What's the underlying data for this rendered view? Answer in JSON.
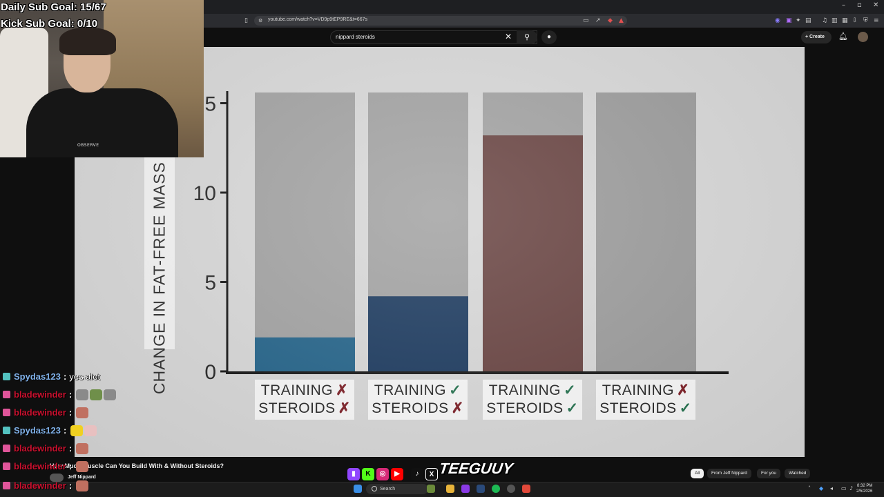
{
  "browser": {
    "url": "youtube.com/watch?v=VD9p9tEP9RE&t=667s"
  },
  "youtube": {
    "search_query": "nippard steroids",
    "create_label": "Create",
    "video_title": "How Much Muscle Can You Build With & Without Steroids?",
    "channel_name": "Jeff Nippard",
    "chips": [
      "All",
      "From Jeff Nippard",
      "For you",
      "Watched"
    ]
  },
  "chart_data": {
    "type": "bar",
    "title": "",
    "ylabel": "CHANGE IN FAT-FREE MASS (LBS)",
    "ylim": [
      0,
      15
    ],
    "yticks": [
      0,
      5,
      10,
      15
    ],
    "ytick_labels": [
      "0",
      "5",
      "10",
      "5"
    ],
    "categories": [
      {
        "line1": "TRAINING",
        "mark1": "✗",
        "line2": "STEROIDS",
        "mark2": "✗"
      },
      {
        "line1": "TRAINING",
        "mark1": "✓",
        "line2": "STEROIDS",
        "mark2": "✗"
      },
      {
        "line1": "TRAINING",
        "mark1": "✓",
        "line2": "STEROIDS",
        "mark2": "✓"
      },
      {
        "line1": "TRAINING",
        "mark1": "✗",
        "line2": "STEROIDS",
        "mark2": "✓"
      }
    ],
    "values": [
      1.9,
      4.2,
      13.2,
      null
    ],
    "bar_colors": [
      "#1e5f86",
      "#15345a",
      "#643e3c",
      "#9a9a9a"
    ],
    "background_bar_color": "#9f9f9f"
  },
  "stream": {
    "daily_sub_goal": "Daily Sub Goal: 15/67",
    "kick_sub_goal": "Kick Sub Goal: 0/10",
    "webcam_shirt_text": "OBSERVE",
    "social_handle": "TEEGUUY"
  },
  "chat": [
    {
      "user": "Spydas123",
      "color": "#7fb0e8",
      "badge": "#53c2c0",
      "message": "yes alot",
      "emotes": []
    },
    {
      "user": "bladewinder",
      "color": "#c8102e",
      "badge": "#e0559a",
      "message": "",
      "emotes": [
        "#8a8a8a",
        "#6f8f4a",
        "#8a8a8a"
      ]
    },
    {
      "user": "bladewinder",
      "color": "#c8102e",
      "badge": "#e0559a",
      "message": "",
      "emotes": [
        "#c07060"
      ]
    },
    {
      "user": "Spydas123",
      "color": "#7fb0e8",
      "badge": "#53c2c0",
      "message": "",
      "emotes": [
        "#f0d020",
        "#e8c0c0"
      ]
    },
    {
      "user": "bladewinder",
      "color": "#c8102e",
      "badge": "#e0559a",
      "message": "",
      "emotes": [
        "#c07060"
      ]
    },
    {
      "user": "bladewinder",
      "color": "#c8102e",
      "badge": "#e0559a",
      "message": "",
      "emotes": [
        "#c07060"
      ]
    },
    {
      "user": "bladewinder",
      "color": "#c8102e",
      "badge": "#e0559a",
      "message": "",
      "emotes": [
        "#c07060"
      ]
    }
  ],
  "taskbar": {
    "search_label": "Search",
    "time": "8:32 PM",
    "date": "2/5/2026"
  }
}
